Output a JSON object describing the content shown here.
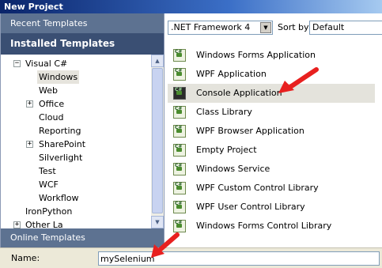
{
  "window": {
    "title": "New Project"
  },
  "left": {
    "recent_templates": "Recent Templates",
    "installed_templates": "Installed Templates",
    "online_templates": "Online Templates",
    "tree": [
      {
        "label": "Visual C#",
        "expander": "−"
      },
      {
        "label": "Windows",
        "selected": true
      },
      {
        "label": "Web"
      },
      {
        "label": "Office",
        "expander": "+"
      },
      {
        "label": "Cloud"
      },
      {
        "label": "Reporting"
      },
      {
        "label": "SharePoint",
        "expander": "+"
      },
      {
        "label": "Silverlight"
      },
      {
        "label": "Test"
      },
      {
        "label": "WCF"
      },
      {
        "label": "Workflow"
      },
      {
        "label": "IronPython"
      },
      {
        "label": "Other La",
        "expander": "+"
      }
    ]
  },
  "toolbar": {
    "framework": ".NET Framework 4",
    "sort_by_label": "Sort by:",
    "sort_by_value": "Default"
  },
  "templates": [
    {
      "label": "Windows Forms Application",
      "icon": "winforms-icon"
    },
    {
      "label": "WPF Application",
      "icon": "wpf-icon"
    },
    {
      "label": "Console Application",
      "icon": "console-icon",
      "selected": true
    },
    {
      "label": "Class Library",
      "icon": "class-library-icon"
    },
    {
      "label": "WPF Browser Application",
      "icon": "wpf-browser-icon"
    },
    {
      "label": "Empty Project",
      "icon": "empty-project-icon"
    },
    {
      "label": "Windows Service",
      "icon": "windows-service-icon"
    },
    {
      "label": "WPF Custom Control Library",
      "icon": "wpf-custom-control-icon"
    },
    {
      "label": "WPF User Control Library",
      "icon": "wpf-user-control-icon"
    },
    {
      "label": "Windows Forms Control Library",
      "icon": "winforms-control-icon"
    }
  ],
  "bottom": {
    "name_label": "Name:",
    "name_value": "mySelenium"
  },
  "colors": {
    "header_dark": "#3a4f73",
    "header_light": "#5d7291",
    "arrow": "#e8201f"
  }
}
